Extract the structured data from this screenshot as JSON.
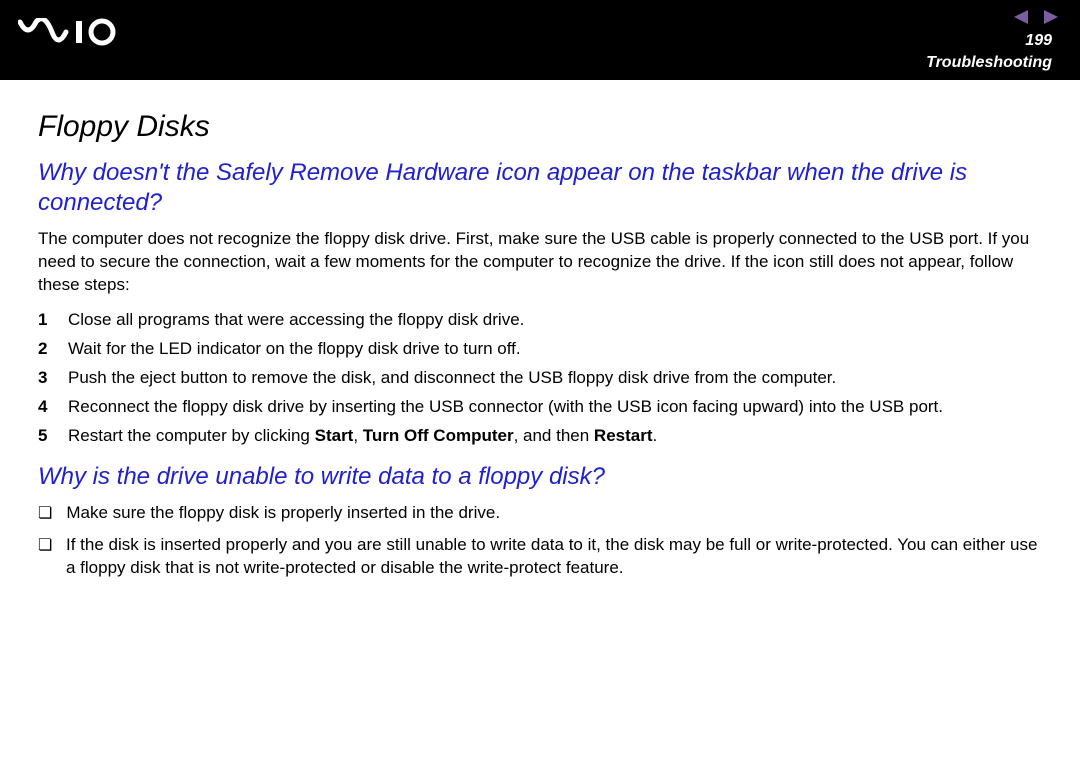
{
  "header": {
    "page_number": "199",
    "section": "Troubleshooting"
  },
  "page": {
    "title": "Floppy Disks"
  },
  "q1": {
    "question": "Why doesn't the Safely Remove Hardware icon appear on the taskbar when the drive is connected?",
    "intro": "The computer does not recognize the floppy disk drive. First, make sure the USB cable is properly connected to the USB port. If you need to secure the connection, wait a few moments for the computer to recognize the drive. If the icon still does not appear, follow these steps:",
    "steps": {
      "n1": "1",
      "s1": "Close all programs that were accessing the floppy disk drive.",
      "n2": "2",
      "s2": "Wait for the LED indicator on the floppy disk drive to turn off.",
      "n3": "3",
      "s3": "Push the eject button to remove the disk, and disconnect the USB floppy disk drive from the computer.",
      "n4": "4",
      "s4": "Reconnect the floppy disk drive by inserting the USB connector (with the USB icon facing upward) into the USB port.",
      "n5": "5",
      "s5_pre": "Restart the computer by clicking ",
      "s5_b1": "Start",
      "s5_sep1": ", ",
      "s5_b2": "Turn Off Computer",
      "s5_sep2": ", and then ",
      "s5_b3": "Restart",
      "s5_post": "."
    }
  },
  "q2": {
    "question": "Why is the drive unable to write data to a floppy disk?",
    "bullets": {
      "b1": "Make sure the floppy disk is properly inserted in the drive.",
      "b2": "If the disk is inserted properly and you are still unable to write data to it, the disk may be full or write-protected. You can either use a floppy disk that is not write-protected or disable the write-protect feature."
    }
  }
}
